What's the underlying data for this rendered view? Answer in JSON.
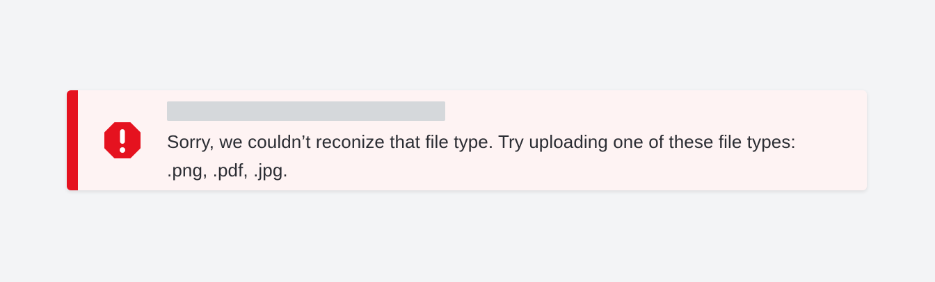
{
  "alert": {
    "severity": "error",
    "icon": "exclamation-octagon-icon",
    "title": "",
    "message": "Sorry, we couldn’t reconize that file type. Try uploading one of these file types: .png, .pdf, .jpg."
  },
  "colors": {
    "page_background": "#f3f4f6",
    "alert_background": "#fef3f3",
    "accent": "#e5121f",
    "title_placeholder": "#d5d8db",
    "text": "#2b2d33"
  }
}
